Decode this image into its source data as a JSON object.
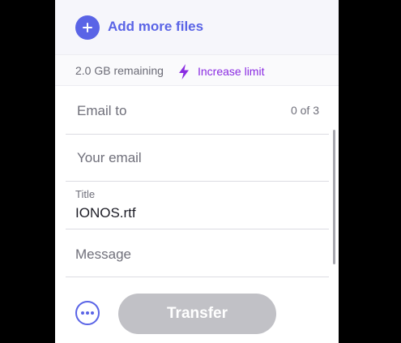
{
  "upload": {
    "add_more_label": "Add more files",
    "remaining_text": "2.0 GB remaining",
    "increase_limit_label": "Increase limit"
  },
  "form": {
    "email_to": {
      "placeholder": "Email to",
      "counter": "0 of 3"
    },
    "your_email": {
      "placeholder": "Your email"
    },
    "title": {
      "label": "Title",
      "value": "IONOS.rtf"
    },
    "message": {
      "placeholder": "Message"
    }
  },
  "actions": {
    "transfer_label": "Transfer"
  },
  "colors": {
    "accent": "#5a64e6",
    "limit_accent": "#8a2be2",
    "disabled_button": "#c1c1c6"
  },
  "icons": {
    "add": "plus-icon",
    "limit": "lightning-bolt-icon",
    "more": "more-options-icon"
  }
}
